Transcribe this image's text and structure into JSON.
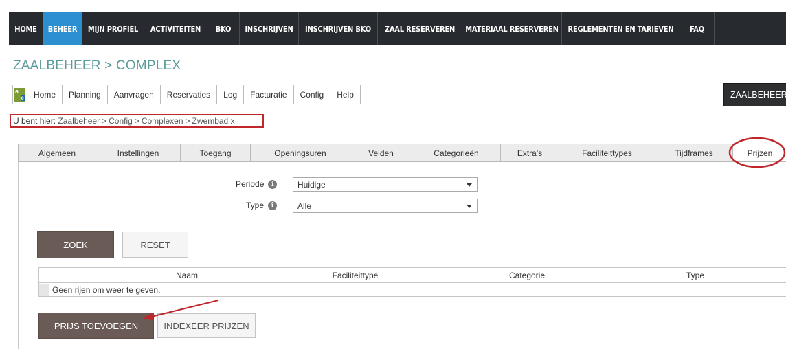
{
  "topnav": {
    "items": [
      "HOME",
      "BEHEER",
      "MIJN PROFIEL",
      "ACTIVITEITEN",
      "BKO",
      "INSCHRIJVEN",
      "INSCHRIJVEN BKO",
      "ZAAL RESERVEREN",
      "MATERIAAL RESERVEREN",
      "REGLEMENTEN EN TARIEVEN",
      "FAQ"
    ],
    "active": "BEHEER"
  },
  "page_title": "ZAALBEHEER > COMPLEX",
  "modbar": {
    "logo_text": "a",
    "logo_badge": "e",
    "items": [
      "Home",
      "Planning",
      "Aanvragen",
      "Reservaties",
      "Log",
      "Facturatie",
      "Config",
      "Help"
    ]
  },
  "zaalbeheer_button": "ZAALBEHEER",
  "breadcrumb": {
    "prefix": "U bent hier:",
    "crumbs": [
      "Zaalbeheer",
      "Config",
      "Complexen",
      "Zwembad x"
    ],
    "separator": ">"
  },
  "tabs": {
    "items": [
      "Algemeen",
      "Instellingen",
      "Toegang",
      "Openingsuren",
      "Velden",
      "Categorieën",
      "Extra's",
      "Faciliteittypes",
      "Tijdframes",
      "Prijzen"
    ],
    "active": "Prijzen"
  },
  "filters": {
    "periode_label": "Periode",
    "periode_value": "Huidige",
    "type_label": "Type",
    "type_value": "Alle"
  },
  "buttons": {
    "zoek": "ZOEK",
    "reset": "RESET",
    "prijs_toevoegen": "PRIJS TOEVOEGEN",
    "indexeer_prijzen": "INDEXEER PRIJZEN"
  },
  "table": {
    "columns": [
      "Naam",
      "Faciliteittype",
      "Categorie",
      "Type"
    ],
    "empty_message": "Geen rijen om weer te geven."
  },
  "colors": {
    "nav_bg": "#272a2e",
    "nav_active": "#2b8fd0",
    "title": "#5b9a9b",
    "primary_button": "#6b5b56",
    "annotation": "#c0272d"
  },
  "icons": {
    "info": "info-icon",
    "dropdown": "chevron-down-icon"
  }
}
